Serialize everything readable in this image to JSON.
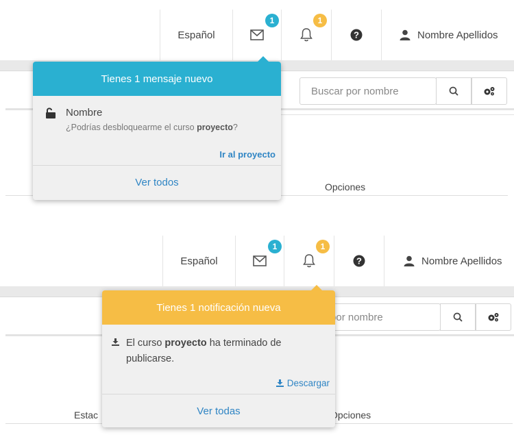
{
  "colors": {
    "accent_blue": "#2ab0d1",
    "accent_yellow": "#f6bd45",
    "link_blue": "#2f85c4"
  },
  "nav": {
    "language": "Español",
    "messages_badge": "1",
    "notifications_badge": "1",
    "user_name": "Nombre Apellidos",
    "icons": [
      "envelope-icon",
      "bell-icon",
      "question-circle-icon",
      "user-icon"
    ]
  },
  "search": {
    "placeholder": "Buscar por nombre",
    "placeholder_cropped": "car por nombre"
  },
  "table": {
    "options_label": "Opciones",
    "options_label_cropped": "Opciones",
    "status_label_cropped": "Estac"
  },
  "messages_popover": {
    "header": "Tiene 1 mensaje nuevo",
    "header_full": "Tienes 1 mensaje nuevo",
    "sender": "Nombre",
    "message": "¿Podrías desbloquearme el curso ",
    "message_bold": "proyecto",
    "message_end": "?",
    "action_link": "Ir al proyecto",
    "footer": "Ver todos"
  },
  "notifications_popover": {
    "header": "Tienes 1 notificación nueva",
    "text_start": "El curso ",
    "text_bold": "proyecto",
    "text_mid": " ha terminado de",
    "text_line2": "publicarse.",
    "action_link": "Descargar",
    "footer": "Ver todas"
  }
}
